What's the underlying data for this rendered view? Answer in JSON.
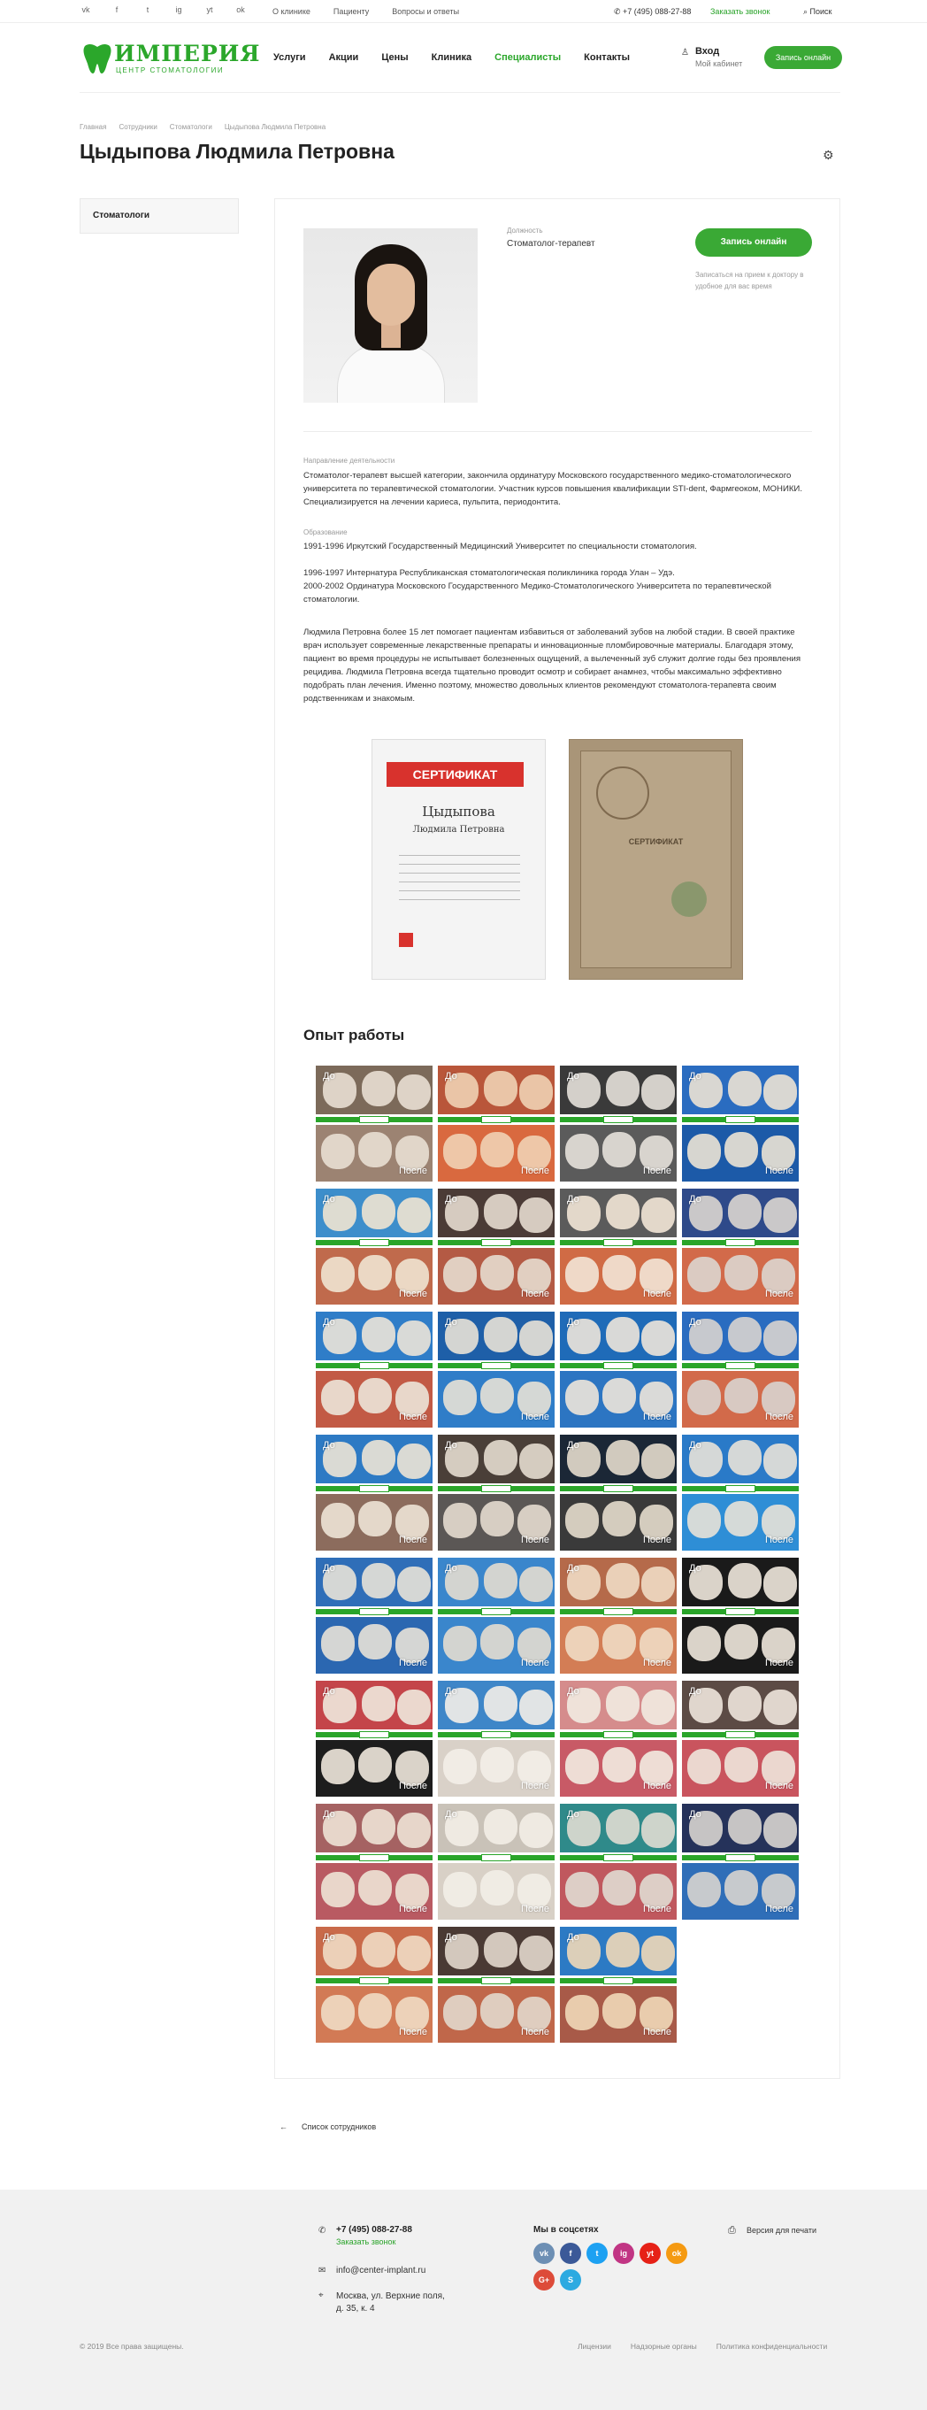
{
  "topbar": {
    "socials": [
      "vk",
      "f",
      "t",
      "ig",
      "yt",
      "ok"
    ],
    "links": [
      "О клинике",
      "Пациенту",
      "Вопросы и ответы"
    ],
    "phone": "+7 (495) 088-27-88",
    "callback": "Заказать звонок",
    "search": "Поиск"
  },
  "header": {
    "logo_name": "ИМПЕРИЯ",
    "logo_sub": "ЦЕНТР СТОМАТОЛОГИИ",
    "nav": [
      "Услуги",
      "Акции",
      "Цены",
      "Клиника",
      "Специалисты",
      "Контакты"
    ],
    "login": "Вход",
    "cabinet": "Мой кабинет",
    "book": "Запись онлайн"
  },
  "breadcrumb": [
    "Главная",
    "Сотрудники",
    "Стоматологи",
    "Цыдыпова Людмила Петровна"
  ],
  "page_title": "Цыдыпова Людмила Петровна",
  "sidebar": {
    "item": "Стоматологи"
  },
  "doctor": {
    "position_label": "Должность",
    "position": "Стоматолог-терапевт",
    "book": "Запись онлайн",
    "book_note": "Записаться на прием к доктору в удобное для вас время"
  },
  "bio": {
    "direction_label": "Направление деятельности",
    "direction_text": "Стоматолог-терапевт высшей категории, закончила ординатуру Московского государственного медико-стоматологического университета по терапевтической стоматологии. Участник курсов повышения квалификации STI-dent, Фармгеоком, МОНИКИ. Специализируется на лечении кариеса, пульпита, периодонтита.",
    "education_label": "Образование",
    "edu1": "1991-1996 Иркутский Государственный Медицинский Университет по специальности стоматология.",
    "edu2": "1996-1997 Интернатура Республиканская стоматологическая поликлиника города Улан – Удэ.",
    "edu3": "2000-2002 Ординатура Московского Государственного Медико-Стоматологического Университета по терапевтической стоматологии.",
    "about": "Людмила Петровна более 15 лет помогает пациентам избавиться от заболеваний зубов на любой стадии. В своей практике врач использует современные лекарственные препараты и инновационные пломбировочные материалы. Благодаря этому, пациент во время процедуры не испытывает болезненных ощущений, а вылеченный зуб служит долгие годы без проявления рецидива. Людмила Петровна всегда тщательно проводит осмотр и собирает анамнез, чтобы максимально эффективно подобрать план лечения. Именно поэтому, множество довольных клиентов рекомендуют стоматолога-терапевта своим родственникам и знакомым."
  },
  "certificates": {
    "c1_title": "СЕРТИФИКАТ",
    "c1_name1": "Цыдыпова",
    "c1_name2": "Людмила Петровна",
    "c2_title": "СЕРТИФИКАТ"
  },
  "experience": {
    "title": "Опыт работы",
    "before": "До",
    "after": "После",
    "tiles": [
      {
        "top": "#7c6a5a",
        "bot": "#9c8372",
        "tooth": "#e9dfd3"
      },
      {
        "top": "#b9563a",
        "bot": "#d9693f",
        "tooth": "#f0d2b4"
      },
      {
        "top": "#3a3a3a",
        "bot": "#5b5b5b",
        "tooth": "#e6e1da"
      },
      {
        "top": "#2a6cc0",
        "bot": "#1c5aa8",
        "tooth": "#ece3d4"
      },
      {
        "top": "#3d8ecb",
        "bot": "#c06a4c",
        "tooth": "#efe4d2"
      },
      {
        "top": "#4b3b36",
        "bot": "#b45a44",
        "tooth": "#e6dccf"
      },
      {
        "top": "#5b5b5b",
        "bot": "#d06b45",
        "tooth": "#f2e6d6"
      },
      {
        "top": "#2e4a8a",
        "bot": "#d26a4a",
        "tooth": "#dcd6cf"
      },
      {
        "top": "#2f7dc8",
        "bot": "#c25a45",
        "tooth": "#ece4d8"
      },
      {
        "top": "#1e5fa8",
        "bot": "#2f7dc8",
        "tooth": "#e8e2d6"
      },
      {
        "top": "#1f6bb8",
        "bot": "#2c75c2",
        "tooth": "#ede6da"
      },
      {
        "top": "#2a6cc0",
        "bot": "#d26a4a",
        "tooth": "#d8d4cf"
      },
      {
        "top": "#2d7ac4",
        "bot": "#8c6c5d",
        "tooth": "#ede4d6"
      },
      {
        "top": "#4a3f38",
        "bot": "#5b5755",
        "tooth": "#e4dbcf"
      },
      {
        "top": "#1b2736",
        "bot": "#3a3a3a",
        "tooth": "#e6ddcd"
      },
      {
        "top": "#2a7ac8",
        "bot": "#2e8ed6",
        "tooth": "#e8e2d8"
      },
      {
        "top": "#2f6eb8",
        "bot": "#2b67b1",
        "tooth": "#e8e2d8"
      },
      {
        "top": "#3a86cc",
        "bot": "#3a86cc",
        "tooth": "#e4ddd0"
      },
      {
        "top": "#b56a4a",
        "bot": "#d37d55",
        "tooth": "#f0dcc4"
      },
      {
        "top": "#1a1a1a",
        "bot": "#1a1a1a",
        "tooth": "#efe8dd"
      },
      {
        "top": "#c4454a",
        "bot": "#1d1d1d",
        "tooth": "#efe8dd"
      },
      {
        "top": "#3e86c8",
        "bot": "#d9d1c8",
        "tooth": "#f3eee8"
      },
      {
        "top": "#d58c8c",
        "bot": "#c85a66",
        "tooth": "#f2ebe1"
      },
      {
        "top": "#5c4b45",
        "bot": "#c9545e",
        "tooth": "#eee6dc"
      },
      {
        "top": "#a56262",
        "bot": "#b95a62",
        "tooth": "#eee3d6"
      },
      {
        "top": "#c9c2b8",
        "bot": "#d8d0c6",
        "tooth": "#f3eee7"
      },
      {
        "top": "#2f8a8a",
        "bot": "#c0585e",
        "tooth": "#e0dbd2"
      },
      {
        "top": "#25325a",
        "bot": "#2f6eb8",
        "tooth": "#d8d4cf"
      },
      {
        "top": "#c96a4a",
        "bot": "#d27a55",
        "tooth": "#f0dcc4"
      },
      {
        "top": "#4a3a34",
        "bot": "#c0674a",
        "tooth": "#e2d8cc"
      },
      {
        "top": "#2c7ac4",
        "bot": "#a85a48",
        "tooth": "#f0d8b8"
      }
    ]
  },
  "back_link": "Список сотрудников",
  "footer": {
    "phone": "+7 (495) 088-27-88",
    "callback": "Заказать звонок",
    "email": "info@center-implant.ru",
    "address": "Москва, ул. Верхние поля, д. 35, к. 4",
    "social_title": "Мы в соцсетях",
    "print": "Версия для печати",
    "copyright": "© 2019 Все права защищены.",
    "links": [
      "Лицензии",
      "Надзорные органы",
      "Политика конфиденциальности"
    ],
    "socials": [
      {
        "label": "vk",
        "color": "#6d8fb4"
      },
      {
        "label": "f",
        "color": "#3b5998"
      },
      {
        "label": "t",
        "color": "#1da1f2"
      },
      {
        "label": "ig",
        "color": "#c13584"
      },
      {
        "label": "yt",
        "color": "#e62117"
      },
      {
        "label": "ok",
        "color": "#f59a12"
      },
      {
        "label": "G+",
        "color": "#dd4b39"
      },
      {
        "label": "S",
        "color": "#2daae1"
      }
    ]
  }
}
